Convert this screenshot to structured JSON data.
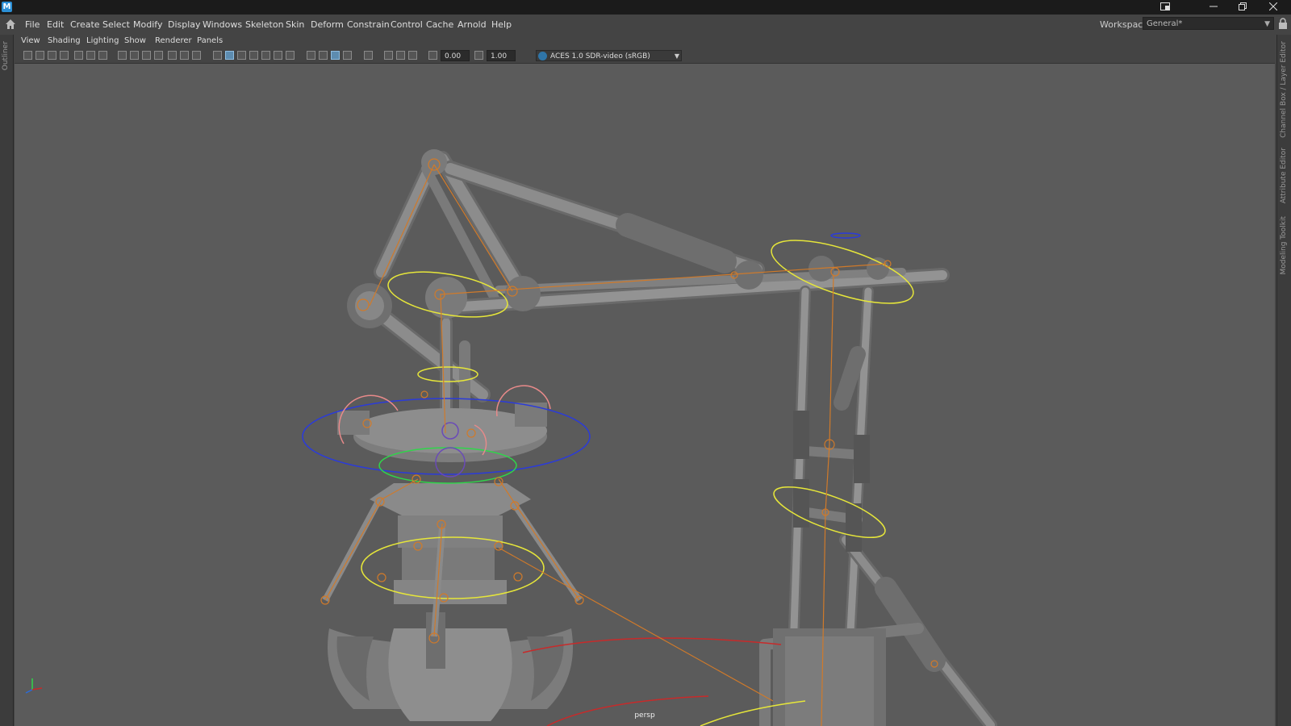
{
  "window": {
    "app_icon_letter": "M",
    "buttons": [
      "restore-icon",
      "minimize-icon",
      "maximize-icon",
      "close-icon"
    ]
  },
  "menu": {
    "items": [
      "File",
      "Edit",
      "Create",
      "Select",
      "Modify",
      "Display",
      "Windows",
      "Skeleton",
      "Skin",
      "Deform",
      "Constrain",
      "Control",
      "Cache",
      "Arnold",
      "Help"
    ]
  },
  "workspace": {
    "label": "Workspace:",
    "value": "General*"
  },
  "left_strip": {
    "label": "Outliner"
  },
  "right_strip": {
    "tabs": [
      "Channel Box / Layer Editor",
      "Attribute Editor",
      "Modeling Toolkit"
    ]
  },
  "panel_menu": {
    "items": [
      "View",
      "Shading",
      "Lighting",
      "Show",
      "Renderer",
      "Panels"
    ]
  },
  "panel_toolbar": {
    "exposure": "0.00",
    "gamma": "1.00",
    "color_space": "ACES 1.0 SDR-video (sRGB)"
  },
  "viewport": {
    "camera": "persp",
    "background": "#5b5b5b",
    "mesh_color": "#8a8a8a",
    "joint_color": "#d07a2a",
    "ctrl_yellow": "#e6e63a",
    "ctrl_blue": "#2b3bd9",
    "ctrl_green": "#2fd64a",
    "ctrl_pink": "#e88a8a",
    "ctrl_red": "#c82a2a"
  }
}
